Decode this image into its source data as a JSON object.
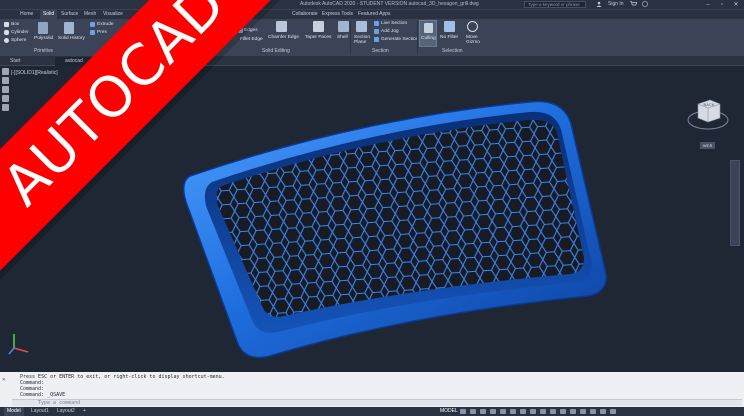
{
  "title_bar": {
    "title": "Autodesk AutoCAD 2020 - STUDENT VERSION   autocad_3D_hexagon_grill.dwg",
    "search_placeholder": "Type a keyword or phrase",
    "sign_in": "Sign In"
  },
  "ribbon_tabs": [
    "Home",
    "Solid",
    "Surface",
    "Mesh",
    "Visualize",
    "Collaborate",
    "Express Tools",
    "Featured Apps"
  ],
  "active_ribbon_tab": "Solid",
  "ribbon": {
    "primitive": [
      "Box",
      "Cylinder",
      "Sphere"
    ],
    "polysolid": "Polysolid",
    "solid_history": "Solid History",
    "extrude": "Extrude",
    "presspull": "Pres",
    "primitive_group": "Primitive",
    "fillet_edge": "Fillet Edge",
    "chamfer_edge": "Chamfer Edge",
    "taper_faces": "Taper Faces",
    "shell": "Shell",
    "extract_edges": "Edges",
    "solid_editing_group": "Solid Editing",
    "section_plane": "Section Plane",
    "live_section": "Live Section",
    "add_jog": "Add Jog",
    "generate_section": "Generate Section",
    "section_group": "Section",
    "culling": "Culling",
    "no_filter": "No Filter",
    "move_gizmo": "Move Gizmo",
    "selection_group": "Selection"
  },
  "file_tabs": [
    "Start",
    "autocad"
  ],
  "viewport": {
    "label": "[-][SOLID1][Realistic]",
    "viewcube_face": "BACK",
    "wcs": "WCS"
  },
  "command_line": {
    "history": [
      "Press ESC or ENTER to exit, or right-click to display shortcut-menu.",
      "Command:",
      "Command:",
      "Command: _QSAVE"
    ],
    "placeholder": "Type a command"
  },
  "status_bar": {
    "layout_tabs": [
      "Model",
      "Layout1",
      "Layout2"
    ],
    "model_label": "MODEL"
  },
  "banner": {
    "text": "AUTOCAD",
    "color": "#ff0000"
  },
  "colors": {
    "grill_blue": "#1f6fe0",
    "viewport_bg": "#1f2634",
    "ribbon_bg": "#3b4456"
  }
}
